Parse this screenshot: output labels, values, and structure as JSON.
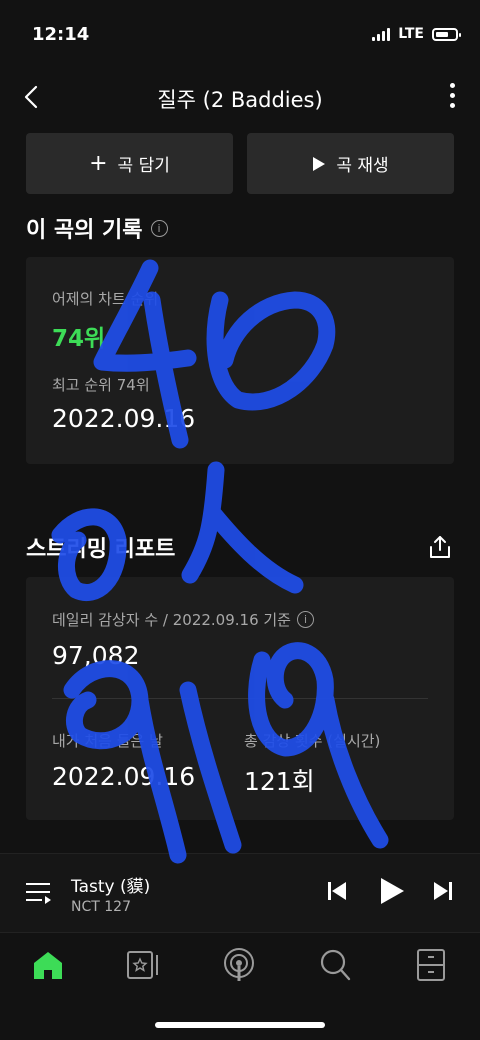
{
  "status": {
    "time": "12:14",
    "network": "LTE"
  },
  "header": {
    "title": "질주 (2 Baddies)"
  },
  "actions": {
    "add_label": "곡 담기",
    "play_label": "곡 재생"
  },
  "record": {
    "title": "이 곡의 기록",
    "yesterday_label": "어제의 차트 순위",
    "yesterday_value": "74위",
    "best_label": "최고 순위 74위",
    "best_date": "2022.09.16"
  },
  "streaming": {
    "title": "스트리밍 리포트",
    "daily_label": "데일리 감상자 수 / 2022.09.16 기준",
    "daily_value": "97,082",
    "first_label": "내가 처음 들은 날",
    "first_value": "2022.09.16",
    "total_label": "총 감상 횟수 (실시간)",
    "total_value": "121회"
  },
  "player": {
    "song": "Tasty (貘)",
    "artist": "NCT 127"
  },
  "colors": {
    "accent_green": "#3ddc57",
    "scribble_blue": "#1f4de8",
    "background": "#121212"
  },
  "icons": [
    "back-icon",
    "more-icon",
    "plus-icon",
    "play-icon",
    "info-icon",
    "share-icon",
    "queue-icon",
    "previous-icon",
    "next-icon",
    "home-icon",
    "library-icon",
    "podcast-icon",
    "search-icon",
    "storage-icon"
  ]
}
